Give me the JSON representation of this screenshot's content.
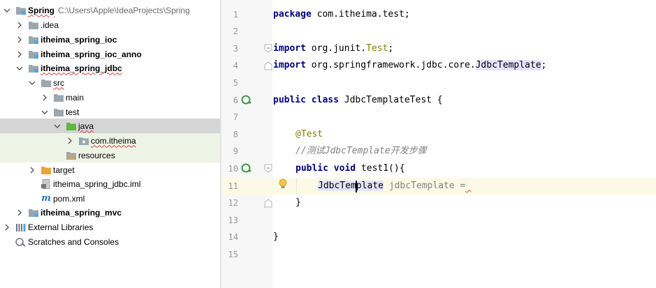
{
  "project_tree": {
    "root": {
      "name": "Spring",
      "path": "C:\\Users\\Apple\\IdeaProjects\\Spring"
    },
    "items": [
      {
        "label": ".idea"
      },
      {
        "label": "itheima_spring_ioc"
      },
      {
        "label": "itheima_spring_ioc_anno"
      },
      {
        "label": "itheima_spring_jdbc"
      },
      {
        "label": "src"
      },
      {
        "label": "main"
      },
      {
        "label": "test"
      },
      {
        "label": "java"
      },
      {
        "label": "com.itheima"
      },
      {
        "label": "resources"
      },
      {
        "label": "target"
      },
      {
        "label": "itheima_spring_jdbc.iml"
      },
      {
        "label": "pom.xml"
      },
      {
        "label": "itheima_spring_mvc"
      },
      {
        "label": "External Libraries"
      },
      {
        "label": "Scratches and Consoles"
      }
    ]
  },
  "editor": {
    "line_numbers": [
      "1",
      "2",
      "3",
      "4",
      "5",
      "6",
      "7",
      "8",
      "9",
      "10",
      "11",
      "12",
      "13",
      "14",
      "15"
    ],
    "code": {
      "l1_kw": "package",
      "l1_rest": " com.itheima.test;",
      "l3_kw": "import",
      "l3_pkg": " org.junit.",
      "l3_cls": "Test",
      "l3_end": ";",
      "l4_kw": "import",
      "l4_pkg": " org.springframework.jdbc.core.",
      "l4_cls": "JdbcTemplate",
      "l4_end": ";",
      "l6_kw": "public class",
      "l6_rest": " JdbcTemplateTest {",
      "l8_ann": "@Test",
      "l9_comment": "//测试JdbcTemplate开发步骤",
      "l10_kw": "public void",
      "l10_rest": " test1(){",
      "l11_type": "JdbcTemplate",
      "l11_rest": " jdbcTemplate =",
      "l12": "}",
      "l14": "}"
    }
  },
  "colors": {
    "keyword": "#000080",
    "annotation": "#808000",
    "comment": "#808080",
    "selected_row": "#d5d5d5",
    "caret_row": "#fcfae6"
  },
  "icons": {
    "folder": "folder-icon",
    "module": "module-folder-icon",
    "source_root": "source-root-icon",
    "package": "package-icon",
    "resources": "resources-folder-icon",
    "excluded": "excluded-folder-icon",
    "iml": "iml-file-icon",
    "maven": "maven-pom-icon",
    "libraries": "libraries-icon",
    "scratches": "scratches-icon",
    "run": "run-test-icon",
    "bulb": "intention-bulb-icon"
  }
}
